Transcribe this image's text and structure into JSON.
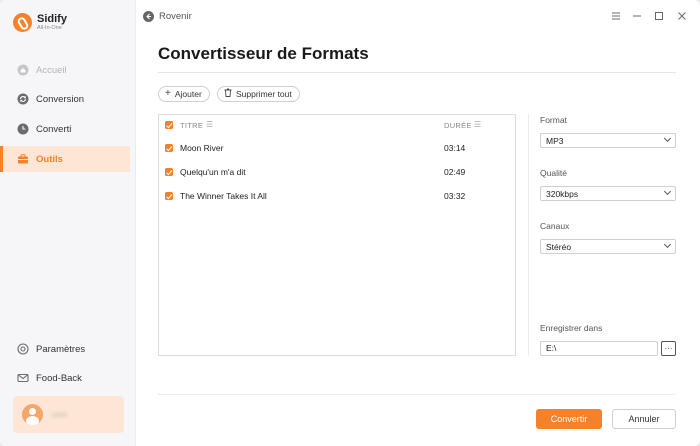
{
  "brand": {
    "name": "Sidify",
    "subtitle": "All-In-One"
  },
  "sidebar": {
    "items": [
      {
        "label": "Accueil",
        "icon": "home-icon",
        "state": "disabled"
      },
      {
        "label": "Conversion",
        "icon": "refresh-icon",
        "state": "normal"
      },
      {
        "label": "Converti",
        "icon": "clock-icon",
        "state": "normal"
      },
      {
        "label": "Outils",
        "icon": "toolbox-icon",
        "state": "active"
      }
    ],
    "bottom_items": [
      {
        "label": "Paramètres",
        "icon": "gear-icon"
      },
      {
        "label": "Food-Back",
        "icon": "mail-icon"
      }
    ],
    "user": {
      "name": "user"
    }
  },
  "topbar": {
    "back_label": "Rovenir"
  },
  "page": {
    "title": "Convertisseur de Formats"
  },
  "toolbar": {
    "add_label": "Ajouter",
    "delete_all_label": "Supprimer tout"
  },
  "table": {
    "columns": {
      "title": "TITRE",
      "duration": "DURÉE"
    },
    "rows": [
      {
        "title": "Moon River",
        "duration": "03:14",
        "checked": true
      },
      {
        "title": "Quelqu'un m'a dit",
        "duration": "02:49",
        "checked": true
      },
      {
        "title": "The Winner Takes It All",
        "duration": "03:32",
        "checked": true
      }
    ]
  },
  "options": {
    "format": {
      "label": "Format",
      "value": "MP3"
    },
    "quality": {
      "label": "Qualité",
      "value": "320kbps"
    },
    "channels": {
      "label": "Canaux",
      "value": "Stéréo"
    },
    "save_to": {
      "label": "Enregistrer dans",
      "value": "E:\\",
      "browse": "···"
    }
  },
  "actions": {
    "convert_label": "Convertir",
    "cancel_label": "Annuler"
  },
  "colors": {
    "accent": "#f5822b",
    "accent_light": "#fde6d6",
    "sidebar_bg": "#f6f6f8"
  }
}
